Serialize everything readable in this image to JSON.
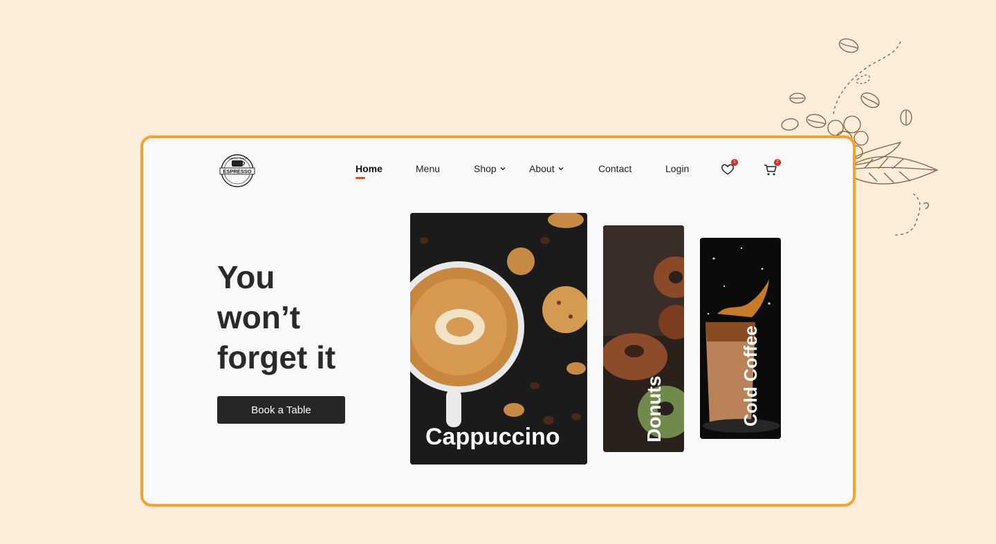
{
  "brand": {
    "logo_text_top": "COFFEE SHOP",
    "logo_text_main": "ESPRESSO"
  },
  "nav": {
    "items": [
      {
        "label": "Home",
        "active": true,
        "dropdown": false
      },
      {
        "label": "Menu",
        "active": false,
        "dropdown": false
      },
      {
        "label": "Shop",
        "active": false,
        "dropdown": true
      },
      {
        "label": "About",
        "active": false,
        "dropdown": true
      },
      {
        "label": "Contact",
        "active": false,
        "dropdown": false
      },
      {
        "label": "Login",
        "active": false,
        "dropdown": false
      }
    ],
    "wishlist_count": "1",
    "cart_count": "2"
  },
  "hero": {
    "title_line1": "You",
    "title_line2": "won’t",
    "title_line3": "forget it",
    "cta_label": "Book a Table"
  },
  "cards": [
    {
      "label": "Cappuccino"
    },
    {
      "label": "Donuts"
    },
    {
      "label": "Cold Coffee"
    }
  ],
  "colors": {
    "page_bg": "#fdeedb",
    "frame_border": "#f7a02a",
    "accent_red": "#e24a1c",
    "badge_red": "#d9281d",
    "button_dark": "#262626"
  },
  "icons": [
    "coffee-beans-illustration",
    "espresso-logo",
    "chevron-down-icon",
    "heart-icon",
    "cart-icon"
  ]
}
